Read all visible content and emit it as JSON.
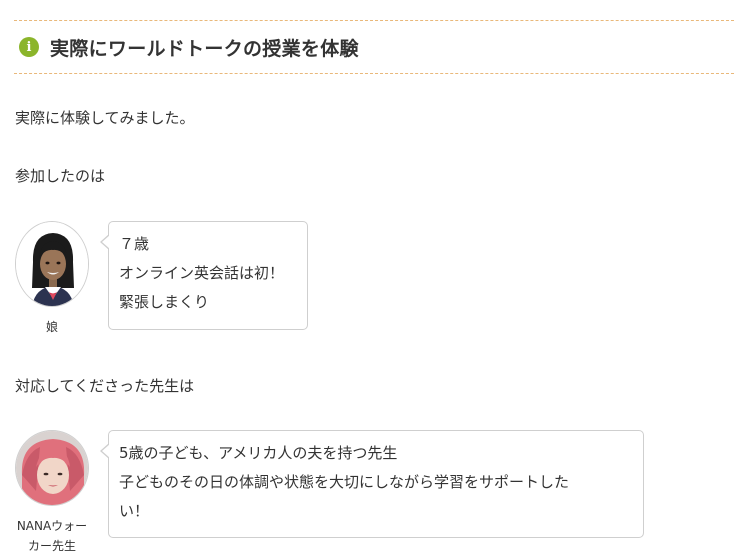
{
  "heading": {
    "icon": "info-icon",
    "icon_color": "#8bb52b",
    "text": "実際にワールドトークの授業を体験"
  },
  "paragraphs": [
    "実際に体験してみました。",
    "参加したのは",
    "対応してくださった先生は"
  ],
  "conversation": [
    {
      "speaker": "娘",
      "lines": [
        "７歳",
        "オンライン英会話は初！",
        "緊張しまくり"
      ]
    },
    {
      "speaker_lines": [
        "NANAウォー",
        "カー先生"
      ],
      "lines": [
        "5歳の子ども、アメリカ人の夫を持つ先生",
        "子どものその日の体調や状態を大切にしながら学習をサポートした",
        "い！"
      ]
    }
  ],
  "colors": {
    "divider": "#e9b87a",
    "bubble_border": "#cfcfcf",
    "text": "#333333"
  }
}
